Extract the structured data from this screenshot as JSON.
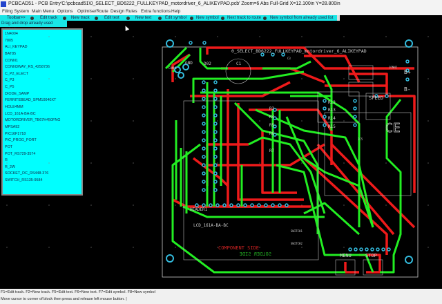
{
  "title": "PCBCAD51 - PCB Entry'C:\\pcbcad51\\0_SELECT_BD6222_FULLKEYPAD_motordriver_6_ALIKEYPAD.pcb' Zoom=6 Abs Full-Grid X=12.100in Y=28.800in",
  "menu": [
    "Filing System",
    "Main Menu",
    "Options",
    "Optimise/Route",
    "Design Rules",
    "Extra functions",
    "Help"
  ],
  "toolbar": {
    "toggle": "Toolbar>>",
    "items": [
      "Edit track",
      "New track",
      "Edit text",
      "New text",
      "Edit symbol",
      "New symbol",
      "Next track to route",
      "New symbol from already used list"
    ]
  },
  "hint": "Drag and drop already used symbols",
  "symbols": [
    "1N4004",
    "7805",
    "ALI_KEYPAD",
    "BAT85",
    "CONN1",
    "CONN3WAY_RS_4258736",
    "C_P2_ELECT",
    "C_P3",
    "C_P5",
    "DIODE_SAMP",
    "FERRITEBEAD_SPM10040XT",
    "HOLE4MM",
    "LCD_161A-BA-BC",
    "MOTORDRIVER_TB67H450FNG",
    "MPSA92",
    "PIC16F1718",
    "PIC_PROG_PORT",
    "POT",
    "POT_RS729-3574",
    "R",
    "R_2W",
    "SOCKET_DC_RS448-376",
    "SWITCH_RS135-9584"
  ],
  "pcb": {
    "board_title": "0_SELECT_BD6222_FULLKEYPAD_motordriver_6_ALIKEYPAD",
    "labels": {
      "gnd": "GND",
      "d02": "D02",
      "c1": "C1",
      "c3": "C3",
      "conn1": "CONN1",
      "conn2": "CONN2",
      "bplus": "B+",
      "bminus": "B-",
      "speed": "SPEED",
      "r12": "R12",
      "r13": "R13",
      "r14": "R14",
      "r15": "R15",
      "r3": "R3",
      "r4": "R4",
      "r5": "R5",
      "r6": "R6",
      "r7": "R7",
      "ic5": "IC5",
      "header": "HEADER1",
      "lcd": "LCD_161A-BA-BC",
      "sw1": "SWITCH1",
      "sw2": "SWITCH2",
      "comp": "COMPONENT SIDE",
      "solder": "SOLDER SIDE",
      "menu": "MENU",
      "stop": "STOP",
      "ce": "CE"
    }
  },
  "status": {
    "keys": "F1=Edit track. F2=New track. F5=Edit text. F6=New text. F7=Edit symbol. F8=New symbol",
    "message": "Move cursor to corner of block then press and release left mouse button. |"
  },
  "colors": {
    "bottom_track": "#ee1a1a",
    "top_track": "#22ee22",
    "pad": "#33bbdd",
    "silk": "#cccccc"
  }
}
